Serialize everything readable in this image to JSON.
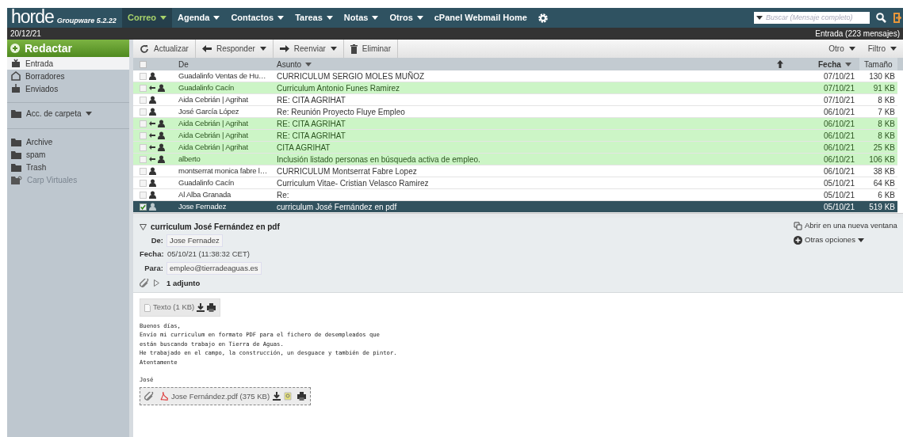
{
  "header": {
    "logo": "horde",
    "version": "Groupware 5.2.22",
    "menu": [
      {
        "label": "Correo",
        "selected": true,
        "dropdown": true
      },
      {
        "label": "Agenda",
        "selected": false,
        "dropdown": true
      },
      {
        "label": "Contactos",
        "selected": false,
        "dropdown": true
      },
      {
        "label": "Tareas",
        "selected": false,
        "dropdown": true
      },
      {
        "label": "Notas",
        "selected": false,
        "dropdown": true
      },
      {
        "label": "Otros",
        "selected": false,
        "dropdown": true
      },
      {
        "label": "cPanel Webmail Home",
        "selected": false,
        "dropdown": false
      }
    ],
    "search": {
      "placeholder": "Buscar (Mensaje completo)"
    }
  },
  "status_bar": {
    "date": "20/12/21",
    "mailbox": "Entrada (223 mensajes)"
  },
  "sidebar": {
    "compose": "Redactar",
    "folders": [
      {
        "label": "Entrada",
        "kind": "inbox",
        "selected": true,
        "disabled": false
      },
      {
        "label": "Borradores",
        "kind": "drafts",
        "selected": false,
        "disabled": false
      },
      {
        "label": "Enviados",
        "kind": "sent",
        "selected": false,
        "disabled": false
      }
    ],
    "folder_actions": "Acc. de carpeta",
    "other_folders": [
      {
        "label": "Archive",
        "kind": "folder",
        "selected": false,
        "disabled": false
      },
      {
        "label": "spam",
        "kind": "folder",
        "selected": false,
        "disabled": false
      },
      {
        "label": "Trash",
        "kind": "folder",
        "selected": false,
        "disabled": false
      },
      {
        "label": "Carp Virtuales",
        "kind": "virtual",
        "selected": false,
        "disabled": true
      }
    ]
  },
  "toolbar": {
    "buttons": [
      {
        "label": "Actualizar",
        "kind": "refresh",
        "dropdown": false
      },
      {
        "label": "Responder",
        "kind": "reply",
        "dropdown": true
      },
      {
        "label": "Reenviar",
        "kind": "forward",
        "dropdown": true
      },
      {
        "label": "Eliminar",
        "kind": "delete",
        "dropdown": false
      }
    ],
    "right": [
      "Otro",
      "Filtro"
    ]
  },
  "table": {
    "select_all": {
      "checked": false
    },
    "columns": [
      "De",
      "Asunto",
      "Fecha",
      "Tamaño"
    ],
    "rows": [
      {
        "from": "Guadalinfo Ventas de Hu…",
        "subject": "CURRICULUM SERGIO MOLES MUÑOZ",
        "date": "07/10/21",
        "size": "130 KB",
        "answered": false,
        "selected": false
      },
      {
        "from": "Guadalinfo Cacín",
        "subject": "Curriculum Antonio Funes Ramirez",
        "date": "07/10/21",
        "size": "91 KB",
        "answered": true,
        "selected": false
      },
      {
        "from": "Aida Cebrián | Agrihat",
        "subject": "RE: CITA AGRIHAT",
        "date": "07/10/21",
        "size": "8 KB",
        "answered": false,
        "selected": false
      },
      {
        "from": "José García López",
        "subject": "Re: Reunión Proyecto Fluye Empleo",
        "date": "06/10/21",
        "size": "7 KB",
        "answered": false,
        "selected": false
      },
      {
        "from": "Aida Cebrián | Agrihat",
        "subject": "RE: CITA AGRIHAT",
        "date": "06/10/21",
        "size": "8 KB",
        "answered": true,
        "selected": false
      },
      {
        "from": "Aida Cebrián | Agrihat",
        "subject": "RE: CITA AGRIHAT",
        "date": "06/10/21",
        "size": "8 KB",
        "answered": true,
        "selected": false
      },
      {
        "from": "Aida Cebrián | Agrihat",
        "subject": "CITA AGRIHAT",
        "date": "06/10/21",
        "size": "25 KB",
        "answered": true,
        "selected": false
      },
      {
        "from": "alberto",
        "subject": "Inclusión listado personas en búsqueda activa de empleo.",
        "date": "06/10/21",
        "size": "106 KB",
        "answered": true,
        "selected": false
      },
      {
        "from": "montserrat monica fabre l…",
        "subject": "CURRICULUM Montserrat Fabre Lopez",
        "date": "06/10/21",
        "size": "38 KB",
        "answered": false,
        "selected": false
      },
      {
        "from": "Guadalinfo Cacín",
        "subject": "Curriculum Vitae- Cristian Velasco Ramirez",
        "date": "05/10/21",
        "size": "64 KB",
        "answered": false,
        "selected": false
      },
      {
        "from": "Al Alba Granada",
        "subject": "Re:",
        "date": "05/10/21",
        "size": "6 KB",
        "answered": false,
        "selected": false
      },
      {
        "from": "Jose Fernadez",
        "subject": "curriculum José Fernández en pdf",
        "date": "05/10/21",
        "size": "519 KB",
        "answered": false,
        "selected": true
      }
    ]
  },
  "preview": {
    "subject": "curriculum José Fernández en pdf",
    "fields": [
      {
        "label": "De:",
        "value": "Jose Fernadez",
        "boxed": true
      },
      {
        "label": "Fecha:",
        "value": "05/10/21 (11:38:32 CET)",
        "boxed": false
      },
      {
        "label": "Para:",
        "value": "empleo@tierradeaguas.es",
        "boxed": true
      }
    ],
    "attachments_summary": "1 adjunto",
    "links": [
      "Abrir en una nueva ventana",
      "Otras opciones"
    ],
    "text_part": "Texto (1 KB)",
    "paragraphs": [
      {
        "lines": [
          "Buenos días,",
          "Envío mi curriculum en formato PDF para el fichero de desempleados que",
          "están buscando trabajo en Tierra de Aguas.",
          "He trabajado en el campo, la construcción, un desguace y también de pintor.",
          "Atentamente"
        ]
      },
      {
        "lines": [
          "José"
        ]
      }
    ],
    "attachment": "Jose Fernández.pdf (375 KB)"
  }
}
